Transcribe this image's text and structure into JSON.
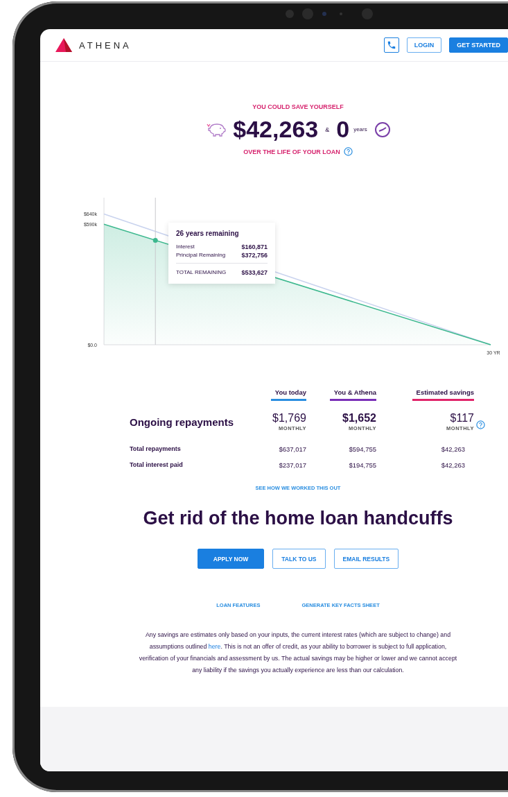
{
  "header": {
    "logo": "ATHENA",
    "buttons": [
      {
        "kind": "phone"
      },
      {
        "kind": "outline",
        "label": "LOGIN"
      },
      {
        "kind": "primary",
        "label": "GET STARTED"
      }
    ]
  },
  "hero": {
    "eyebrow": "YOU COULD SAVE YOURSELF",
    "amount": "$42,263",
    "joiner": "&",
    "years": "0",
    "years_unit": "years",
    "subtitle": "OVER THE LIFE OF YOUR LOAN"
  },
  "chart": {
    "tooltip": {
      "title": "26 years remaining",
      "rows": [
        {
          "label": "Interest",
          "value": "$160,871"
        },
        {
          "label": "Principal Remaining",
          "value": "$372,756"
        }
      ],
      "total": {
        "label": "TOTAL REMAINING",
        "value": "$533,627"
      }
    },
    "chart_data": {
      "type": "line",
      "series": [
        {
          "color": "#3cb88e",
          "values": [
            590000,
            0
          ]
        },
        {
          "color": "#c9d3ee",
          "values": [
            640000,
            0
          ]
        }
      ],
      "ylim": [
        0,
        720000
      ],
      "yticks": [
        {
          "value": 0,
          "label": "$0.0"
        },
        {
          "value": 590000,
          "label": "$590k"
        },
        {
          "value": 640000,
          "label": "$640k"
        }
      ],
      "annotations": [
        {
          "text": "30 YR"
        }
      ]
    },
    "cursor": {
      "level": 0.133
    }
  },
  "comparison": {
    "columns": [
      {
        "label": "You today",
        "color": "#2a8ee0"
      },
      {
        "label": "You & Athena",
        "color": "#7a2fb8"
      },
      {
        "label": "Estimated savings",
        "color": "#e0246a"
      }
    ],
    "featured": {
      "label": "Ongoing repayments",
      "cells": [
        {
          "value": "$1,769",
          "period": "MONTHLY",
          "bold": false
        },
        {
          "value": "$1,652",
          "period": "MONTHLY",
          "bold": true
        },
        {
          "value": "$117",
          "period": "MONTHLY",
          "bold": false,
          "help": true
        }
      ]
    },
    "rows": [
      {
        "label": "Total repayments",
        "values": [
          "$637,017",
          "$594,755",
          "$42,263"
        ]
      },
      {
        "label": "Total interest paid",
        "values": [
          "$237,017",
          "$194,755",
          "$42,263"
        ]
      }
    ],
    "link": "SEE HOW WE WORKED THIS OUT"
  },
  "headline": "Get rid of the home loan handcuffs",
  "buttons": [
    {
      "kind": "primary",
      "label": "APPLY NOW"
    },
    {
      "kind": "outline",
      "label": "TALK TO US"
    },
    {
      "kind": "outline",
      "label": "EMAIL RESULTS"
    }
  ],
  "links": [
    "LOAN FEATURES",
    "GENERATE KEY FACTS SHEET"
  ],
  "disclaimer": {
    "before": "Any savings are estimates only based on your inputs, the current interest rates (which are subject to change) and assumptions outlined",
    "link": "here",
    "after": ". This is not an offer of credit, as your ability to borrower is subject to full application, verification of your financials and assessment by us. The actual savings may be higher or lower and we cannot accept any liability if the savings you actually experience are less than our calculation."
  }
}
